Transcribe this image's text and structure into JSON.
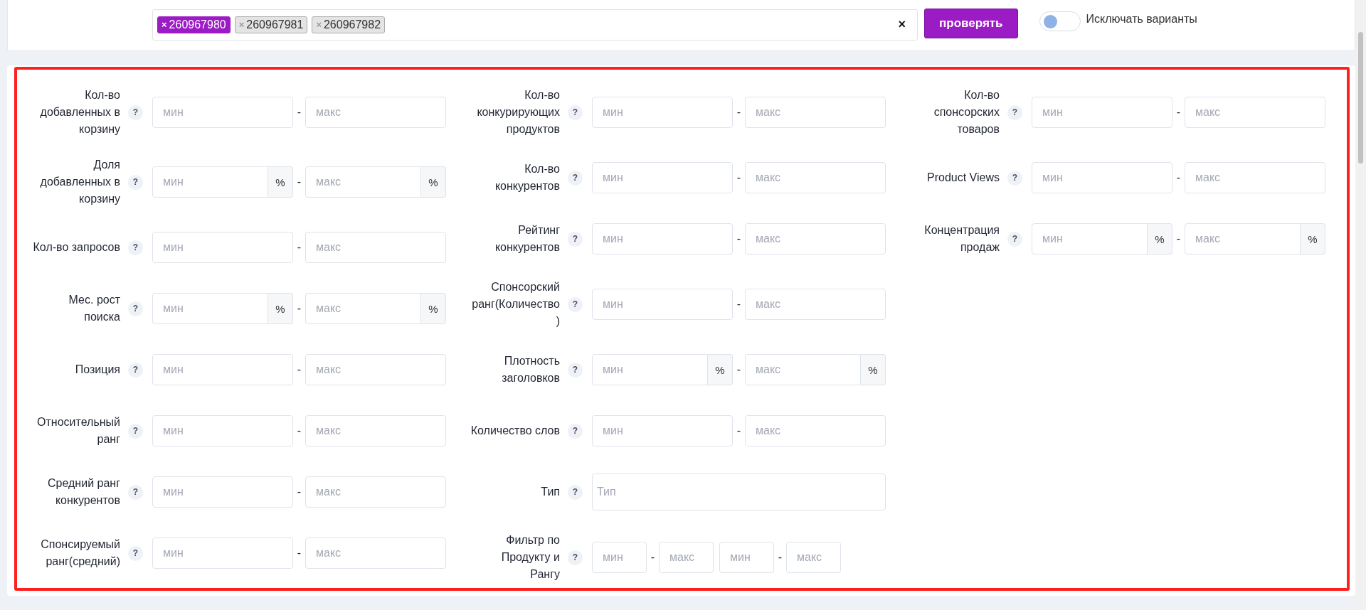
{
  "search_bar": {
    "tags": [
      {
        "label": "260967980",
        "remove": "×",
        "selected": true
      },
      {
        "label": "260967981",
        "remove": "×",
        "selected": false
      },
      {
        "label": "260967982",
        "remove": "×",
        "selected": false
      }
    ],
    "clear": "×",
    "button": "проверять",
    "toggle": {
      "label": "Исключать варианты",
      "on": false
    }
  },
  "filter_columns": [
    {
      "filters": [
        {
          "kind": "range",
          "label": "Кол-во добавленных в корзину",
          "placeholder_min": "мин",
          "placeholder_max": "макс"
        },
        {
          "kind": "percent",
          "label": "Доля добавленных в корзину",
          "placeholder_min": "мин",
          "placeholder_max": "макс",
          "unit": "%",
          "unit_max": "%"
        },
        {
          "kind": "range",
          "label": "Кол-во запросов",
          "placeholder_min": "мин",
          "placeholder_max": "макс"
        },
        {
          "kind": "percent",
          "label": "Мес. рост поиска",
          "placeholder_min": "мин",
          "placeholder_max": "макс",
          "unit": "%",
          "unit_max": "%"
        },
        {
          "kind": "range",
          "label": "Позиция",
          "placeholder_min": "мин",
          "placeholder_max": "макс"
        },
        {
          "kind": "range",
          "label": "Относительный ранг",
          "placeholder_min": "мин",
          "placeholder_max": "макс"
        },
        {
          "kind": "range",
          "label": "Средний ранг конкурентов",
          "placeholder_min": "мин",
          "placeholder_max": "макс"
        },
        {
          "kind": "range",
          "label": "Спонсируемый ранг(средний)",
          "placeholder_min": "мин",
          "placeholder_max": "макс"
        }
      ]
    },
    {
      "filters": [
        {
          "kind": "range",
          "label": "Кол-во конкурирующих продуктов",
          "placeholder_min": "мин",
          "placeholder_max": "макс"
        },
        {
          "kind": "range",
          "label": "Кол-во конкурентов",
          "placeholder_min": "мин",
          "placeholder_max": "макс"
        },
        {
          "kind": "range",
          "label": "Рейтинг конкурентов",
          "placeholder_min": "мин",
          "placeholder_max": "макс"
        },
        {
          "kind": "range",
          "label": "Спонсорский ранг(Количество)",
          "placeholder_min": "мин",
          "placeholder_max": "макс"
        },
        {
          "kind": "percent",
          "label": "Плотность заголовков",
          "placeholder_min": "мин",
          "placeholder_max": "макс",
          "unit": "%",
          "unit_max": "%"
        },
        {
          "kind": "range",
          "label": "Количество слов",
          "placeholder_min": "мин",
          "placeholder_max": "макс"
        },
        {
          "kind": "text",
          "label": "Тип",
          "placeholder": "Тип"
        },
        {
          "kind": "double",
          "label": "Фильтр по Продукту и Рангу",
          "placeholder_min": "мин",
          "placeholder_max": "макс",
          "placeholder_min2": "мин",
          "placeholder_max2": "макс"
        }
      ]
    },
    {
      "filters": [
        {
          "kind": "range",
          "label": "Кол-во спонсорских товаров",
          "placeholder_min": "мин",
          "placeholder_max": "макс"
        },
        {
          "kind": "range",
          "label": "Product Views",
          "placeholder_min": "мин",
          "placeholder_max": "макс"
        },
        {
          "kind": "percent",
          "label": "Концентрация продаж",
          "placeholder_min": "мин",
          "placeholder_max": "макс",
          "unit": "%",
          "unit_max": "%"
        }
      ]
    }
  ],
  "help_mark": "?",
  "dash": "-"
}
